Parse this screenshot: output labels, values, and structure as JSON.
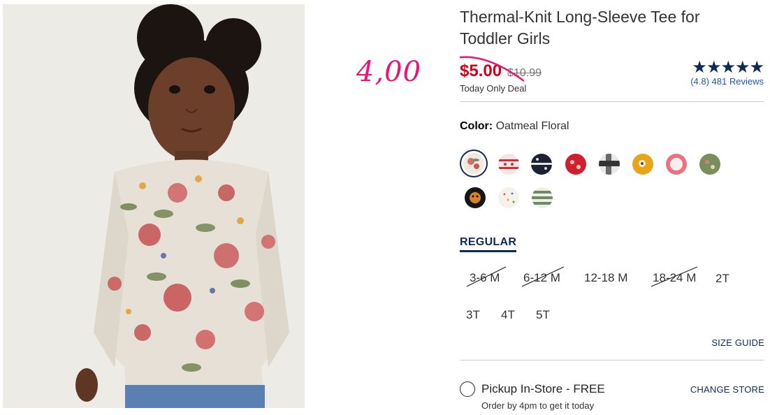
{
  "product": {
    "title": "Thermal-Knit Long-Sleeve Tee for Toddler Girls",
    "sale_price": "$5.00",
    "original_price": "$10.99",
    "deal_note": "Today Only Deal",
    "annotation": "4,00",
    "rating": {
      "stars": "★★★★★",
      "reviews_text": "(4.8) 481 Reviews"
    }
  },
  "color": {
    "label": "Color:",
    "value": "Oatmeal Floral",
    "swatches": [
      {
        "name": "oatmeal-floral",
        "selected": true
      },
      {
        "name": "red-fair-isle",
        "selected": false
      },
      {
        "name": "navy-hearts",
        "selected": false
      },
      {
        "name": "red-floral",
        "selected": false
      },
      {
        "name": "black-white-plaid",
        "selected": false
      },
      {
        "name": "gold-floral",
        "selected": false
      },
      {
        "name": "pink-white",
        "selected": false
      },
      {
        "name": "green-floral",
        "selected": false
      },
      {
        "name": "black-tiger",
        "selected": false
      },
      {
        "name": "cream-dots",
        "selected": false
      },
      {
        "name": "green-stripe",
        "selected": false
      }
    ]
  },
  "fit": {
    "label": "REGULAR"
  },
  "sizes": [
    {
      "label": "3-6 M",
      "available": false
    },
    {
      "label": "6-12 M",
      "available": false
    },
    {
      "label": "12-18 M",
      "available": true
    },
    {
      "label": "18-24 M",
      "available": false
    },
    {
      "label": "2T",
      "available": true
    },
    {
      "label": "3T",
      "available": true
    },
    {
      "label": "4T",
      "available": true
    },
    {
      "label": "5T",
      "available": true
    }
  ],
  "size_guide": "SIZE GUIDE",
  "pickup": {
    "label": "Pickup In-Store - FREE",
    "note": "Order by 4pm to get it today",
    "change_store": "CHANGE STORE"
  },
  "colors": {
    "sale_red": "#d0021b",
    "navy": "#0f2a57",
    "annotation_pink": "#e6157a",
    "link_blue": "#1e5aa8"
  }
}
